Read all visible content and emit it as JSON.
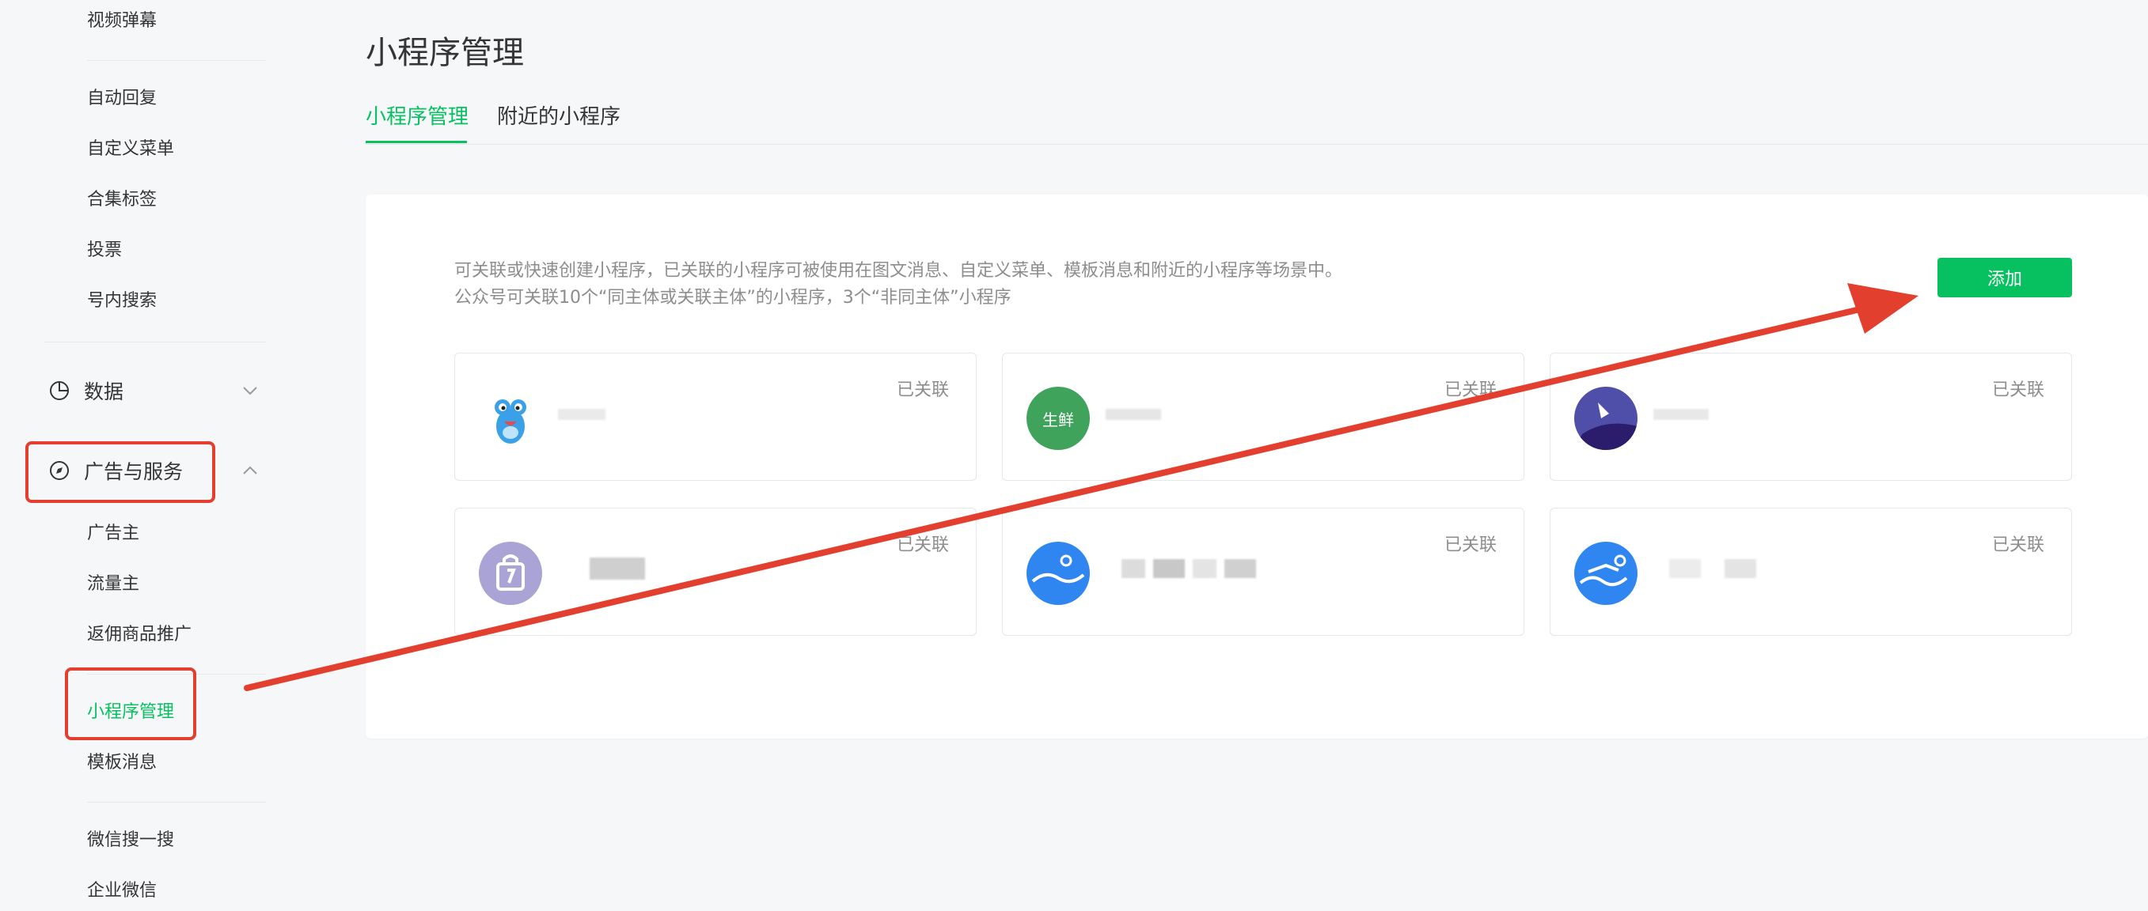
{
  "sidebar": {
    "top_items": [
      "视频弹幕",
      "自动回复",
      "自定义菜单",
      "合集标签",
      "投票",
      "号内搜索"
    ],
    "sections": [
      {
        "label": "数据",
        "icon": "pie-chart-icon",
        "expanded": false
      },
      {
        "label": "广告与服务",
        "icon": "compass-icon",
        "expanded": true
      }
    ],
    "ads_items": [
      "广告主",
      "流量主",
      "返佣商品推广"
    ],
    "service_items": [
      "小程序管理",
      "模板消息"
    ],
    "bottom_items": [
      "微信搜一搜",
      "企业微信"
    ],
    "active_item": "小程序管理"
  },
  "main": {
    "title": "小程序管理",
    "tabs": [
      {
        "label": "小程序管理",
        "active": true
      },
      {
        "label": "附近的小程序",
        "active": false
      }
    ],
    "description": [
      "可关联或快速创建小程序，已关联的小程序可被使用在图文消息、自定义菜单、模板消息和附近的小程序等场景中。",
      "公众号可关联10个“同主体或关联主体”的小程序，3个“非同主体”小程序"
    ],
    "add_button": "添加",
    "cards": [
      {
        "status": "已关联",
        "logo": "cartoon-frog-logo",
        "logo_text": ""
      },
      {
        "status": "已关联",
        "logo": "green-circle-logo",
        "logo_text": "生鲜"
      },
      {
        "status": "已关联",
        "logo": "purple-circle-logo",
        "logo_text": ""
      },
      {
        "status": "已关联",
        "logo": "shopping-bag-logo",
        "logo_text": ""
      },
      {
        "status": "已关联",
        "logo": "blue-wave-logo",
        "logo_text": ""
      },
      {
        "status": "已关联",
        "logo": "blue-swim-logo",
        "logo_text": ""
      }
    ]
  },
  "colors": {
    "accent": "#07c160",
    "annotation_red": "#e23f2f",
    "text": "#353535",
    "muted": "#8d8d8d",
    "background": "#f6f7f9"
  }
}
